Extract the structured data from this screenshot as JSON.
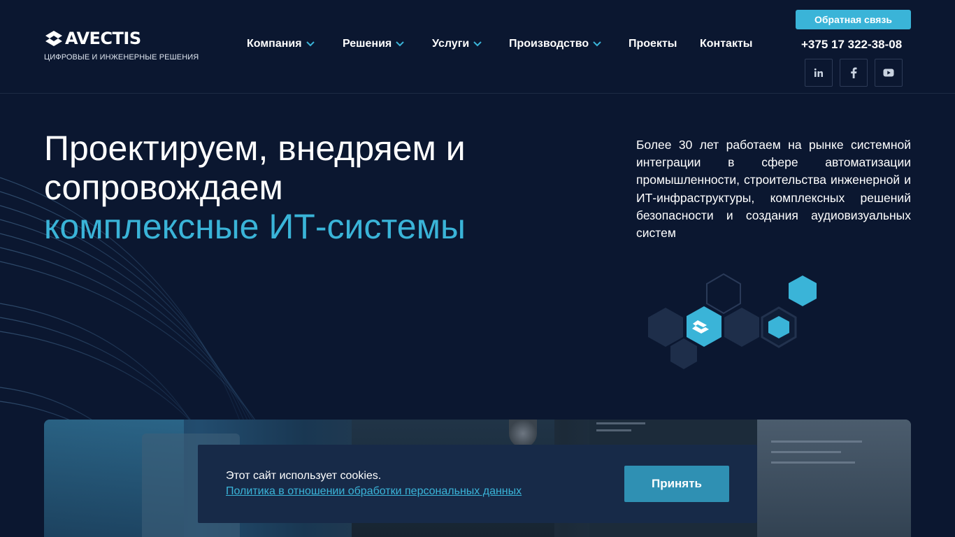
{
  "header": {
    "logo_text": "AVECTIS",
    "logo_subtitle": "ЦИФРОВЫЕ И ИНЖЕНЕРНЫЕ РЕШЕНИЯ",
    "nav": [
      {
        "label": "Компания",
        "dropdown": true
      },
      {
        "label": "Решения",
        "dropdown": true
      },
      {
        "label": "Услуги",
        "dropdown": true
      },
      {
        "label": "Производство",
        "dropdown": true
      },
      {
        "label": "Проекты",
        "dropdown": false
      },
      {
        "label": "Контакты",
        "dropdown": false
      }
    ],
    "feedback_label": "Обратная связь",
    "phone": "+375 17 322-38-08",
    "social": [
      "linkedin-icon",
      "facebook-icon",
      "youtube-icon"
    ]
  },
  "hero": {
    "title_line1": "Проектируем, внедряем и",
    "title_line2": "сопровождаем",
    "title_accent": "комплексные ИТ-системы",
    "description": "Более 30 лет работаем на рынке системной интеграции в сфере автоматизации промышленности, строительства инженерной и ИТ-инфраструктуры, комплексных решений безопасности и создания аудиовизуальных систем"
  },
  "cookie": {
    "text": "Этот сайт использует cookies.",
    "link": "Политика в отношении обработки персональных данных",
    "accept_label": "Принять"
  },
  "colors": {
    "background": "#0b1730",
    "accent": "#3ab4d8",
    "cookie_bg": "#172a48",
    "accept_button": "#2f90b3"
  }
}
